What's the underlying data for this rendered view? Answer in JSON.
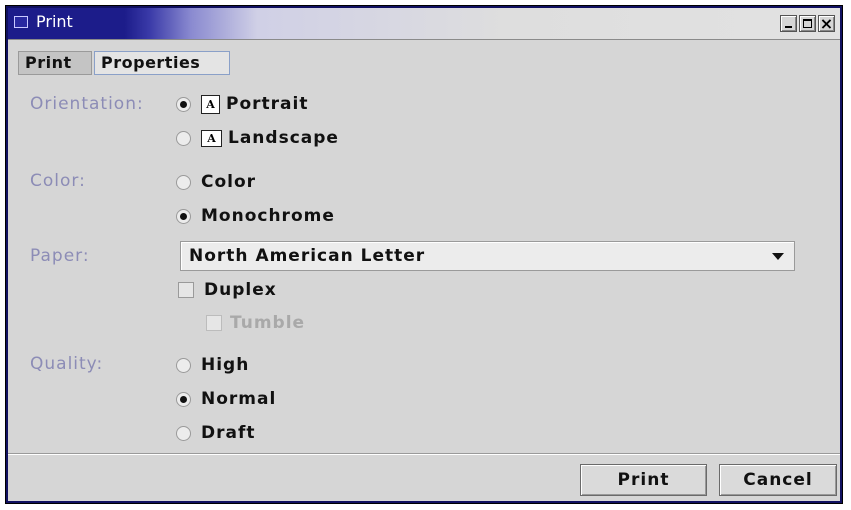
{
  "window": {
    "title": "Print",
    "minimize_glyph": "",
    "maximize_glyph": "",
    "close_glyph": "×"
  },
  "tabs": [
    {
      "label": "Print",
      "selected": true
    },
    {
      "label": "Properties",
      "selected": false
    }
  ],
  "orientation": {
    "label": "Orientation:",
    "options": [
      {
        "label": "Portrait",
        "selected": true,
        "icon": "portrait-page-icon",
        "glyph": "A"
      },
      {
        "label": "Landscape",
        "selected": false,
        "icon": "landscape-page-icon",
        "glyph": "A"
      }
    ]
  },
  "color": {
    "label": "Color:",
    "options": [
      {
        "label": "Color",
        "selected": false
      },
      {
        "label": "Monochrome",
        "selected": true
      }
    ]
  },
  "paper": {
    "label": "Paper:",
    "value": "North American Letter",
    "duplex": {
      "label": "Duplex",
      "checked": false
    },
    "tumble": {
      "label": "Tumble",
      "checked": false,
      "enabled": false
    }
  },
  "quality": {
    "label": "Quality:",
    "options": [
      {
        "label": "High",
        "selected": false
      },
      {
        "label": "Normal",
        "selected": true
      },
      {
        "label": "Draft",
        "selected": false
      }
    ]
  },
  "buttons": {
    "print": "Print",
    "cancel": "Cancel"
  },
  "colors": {
    "title_bar": "#1c1c8a",
    "label_text": "#8c8cb6",
    "window_bg": "#d6d6d6"
  }
}
